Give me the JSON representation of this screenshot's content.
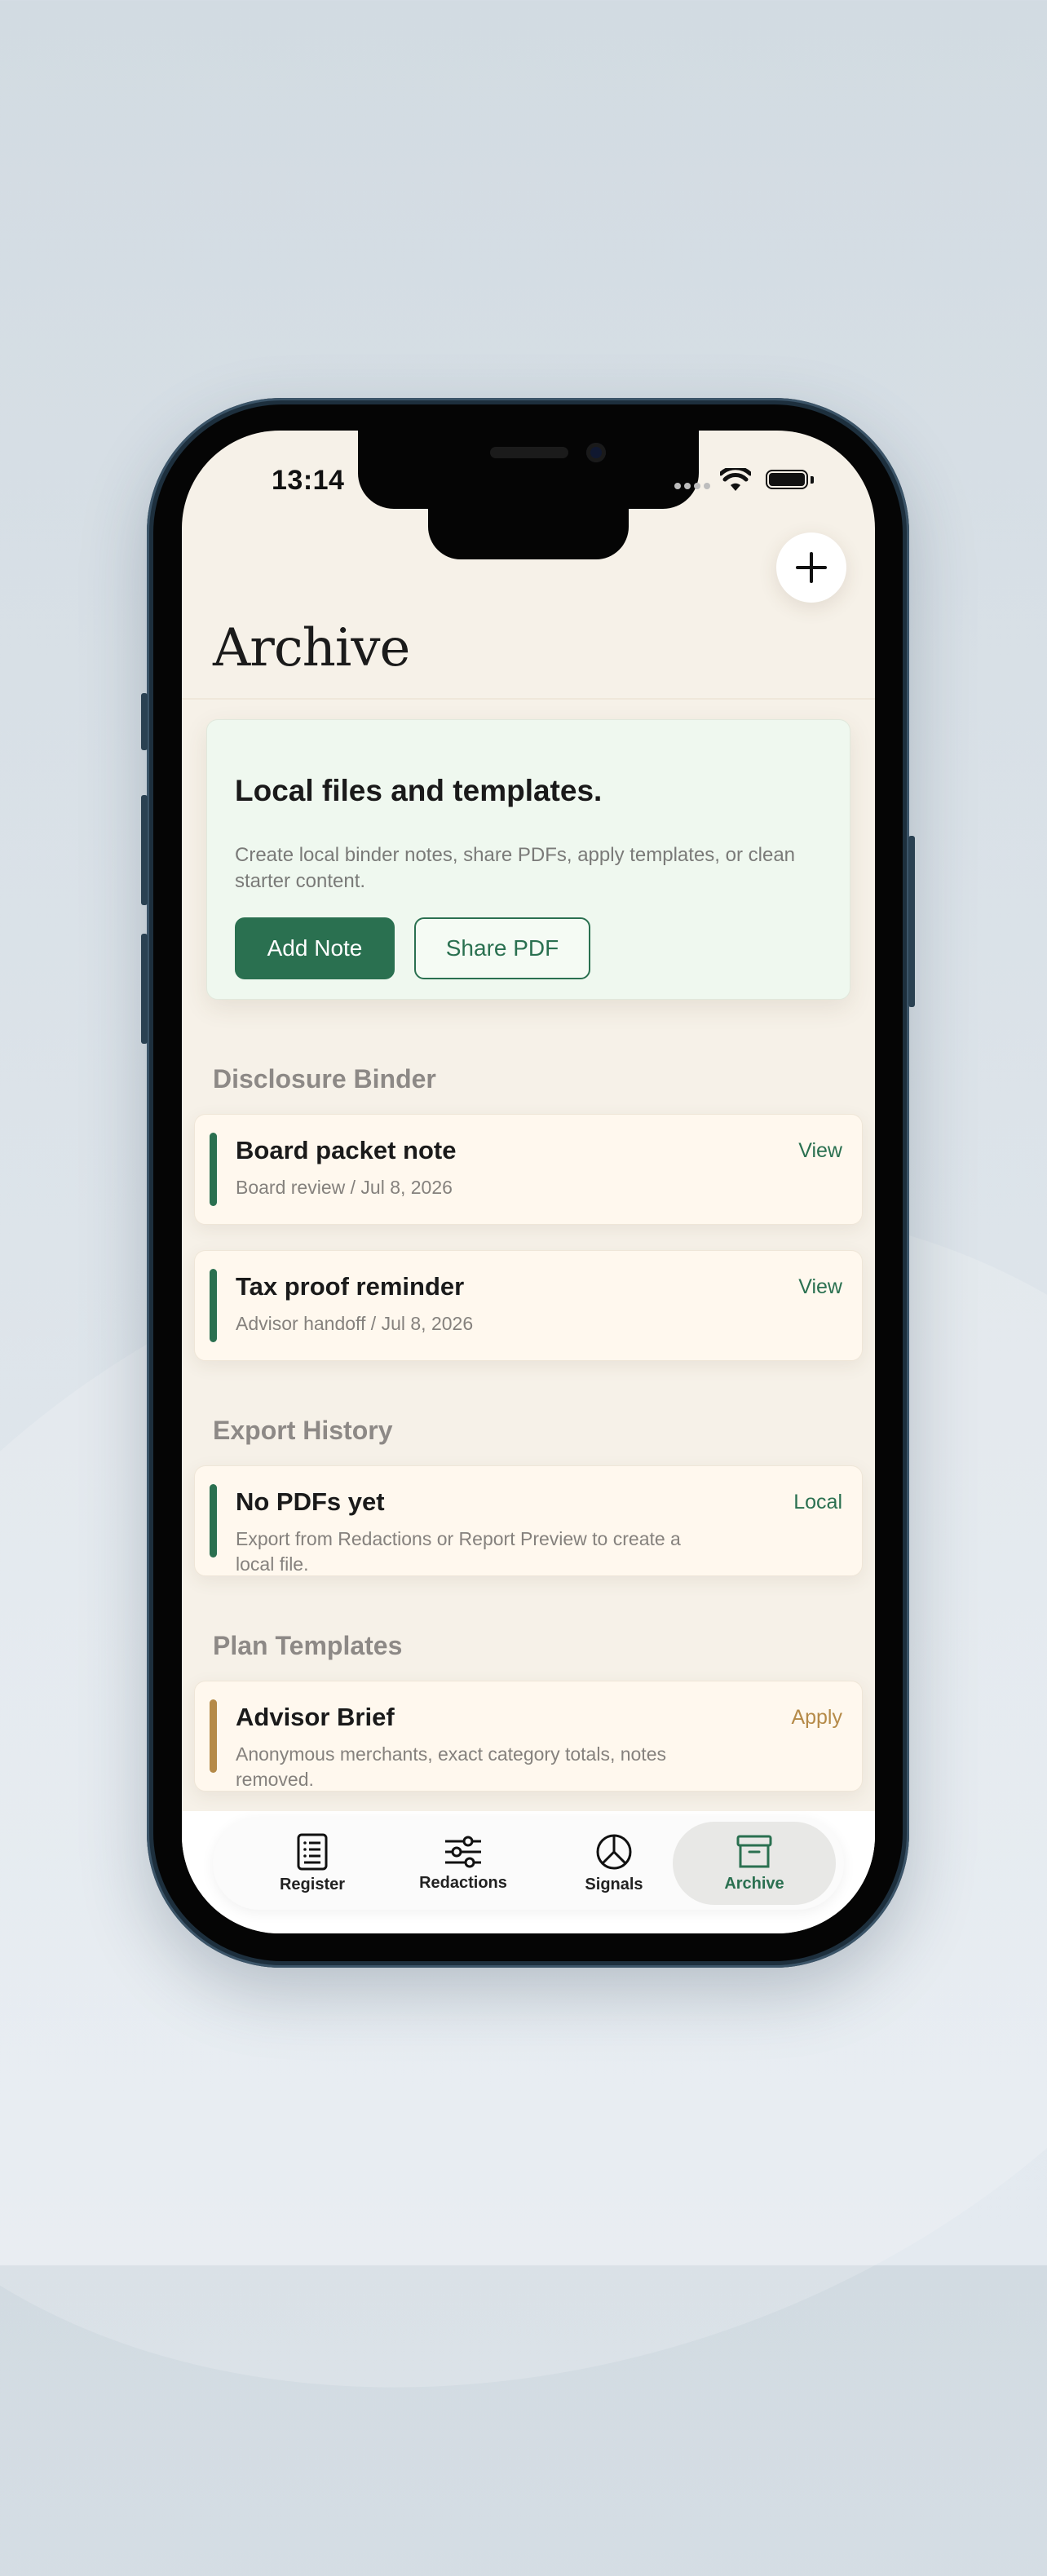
{
  "status_bar": {
    "time": "13:14"
  },
  "header": {
    "title": "Archive",
    "add_button_icon": "plus-icon"
  },
  "hero": {
    "title": "Local files and templates.",
    "description": "Create local binder notes, share PDFs, apply templates, or clean starter content.",
    "primary_button": "Add Note",
    "secondary_button": "Share PDF"
  },
  "sections": {
    "disclosure": {
      "title": "Disclosure Binder",
      "items": [
        {
          "title": "Board packet note",
          "subtitle": "Board review / Jul 8, 2026",
          "action": "View"
        },
        {
          "title": "Tax proof reminder",
          "subtitle": "Advisor handoff / Jul 8, 2026",
          "action": "View"
        }
      ]
    },
    "export": {
      "title": "Export History",
      "items": [
        {
          "title": "No PDFs yet",
          "subtitle": "Export from Redactions or Report Preview to create a local file.",
          "action": "Local"
        }
      ]
    },
    "templates": {
      "title": "Plan Templates",
      "items": [
        {
          "title": "Advisor Brief",
          "subtitle": "Anonymous merchants, exact category totals, notes removed.",
          "action": "Apply"
        }
      ]
    }
  },
  "tabs": [
    {
      "label": "Register",
      "icon": "register-list-icon",
      "active": false
    },
    {
      "label": "Redactions",
      "icon": "sliders-icon",
      "active": false
    },
    {
      "label": "Signals",
      "icon": "pie-chart-icon",
      "active": false
    },
    {
      "label": "Archive",
      "icon": "archive-box-icon",
      "active": true
    }
  ],
  "colors": {
    "accent_green": "#2a7050",
    "template_gold": "#b58a48",
    "background": "#f6f1e8",
    "hero_bg": "#eff8ef",
    "card_bg": "#fff8ee"
  }
}
